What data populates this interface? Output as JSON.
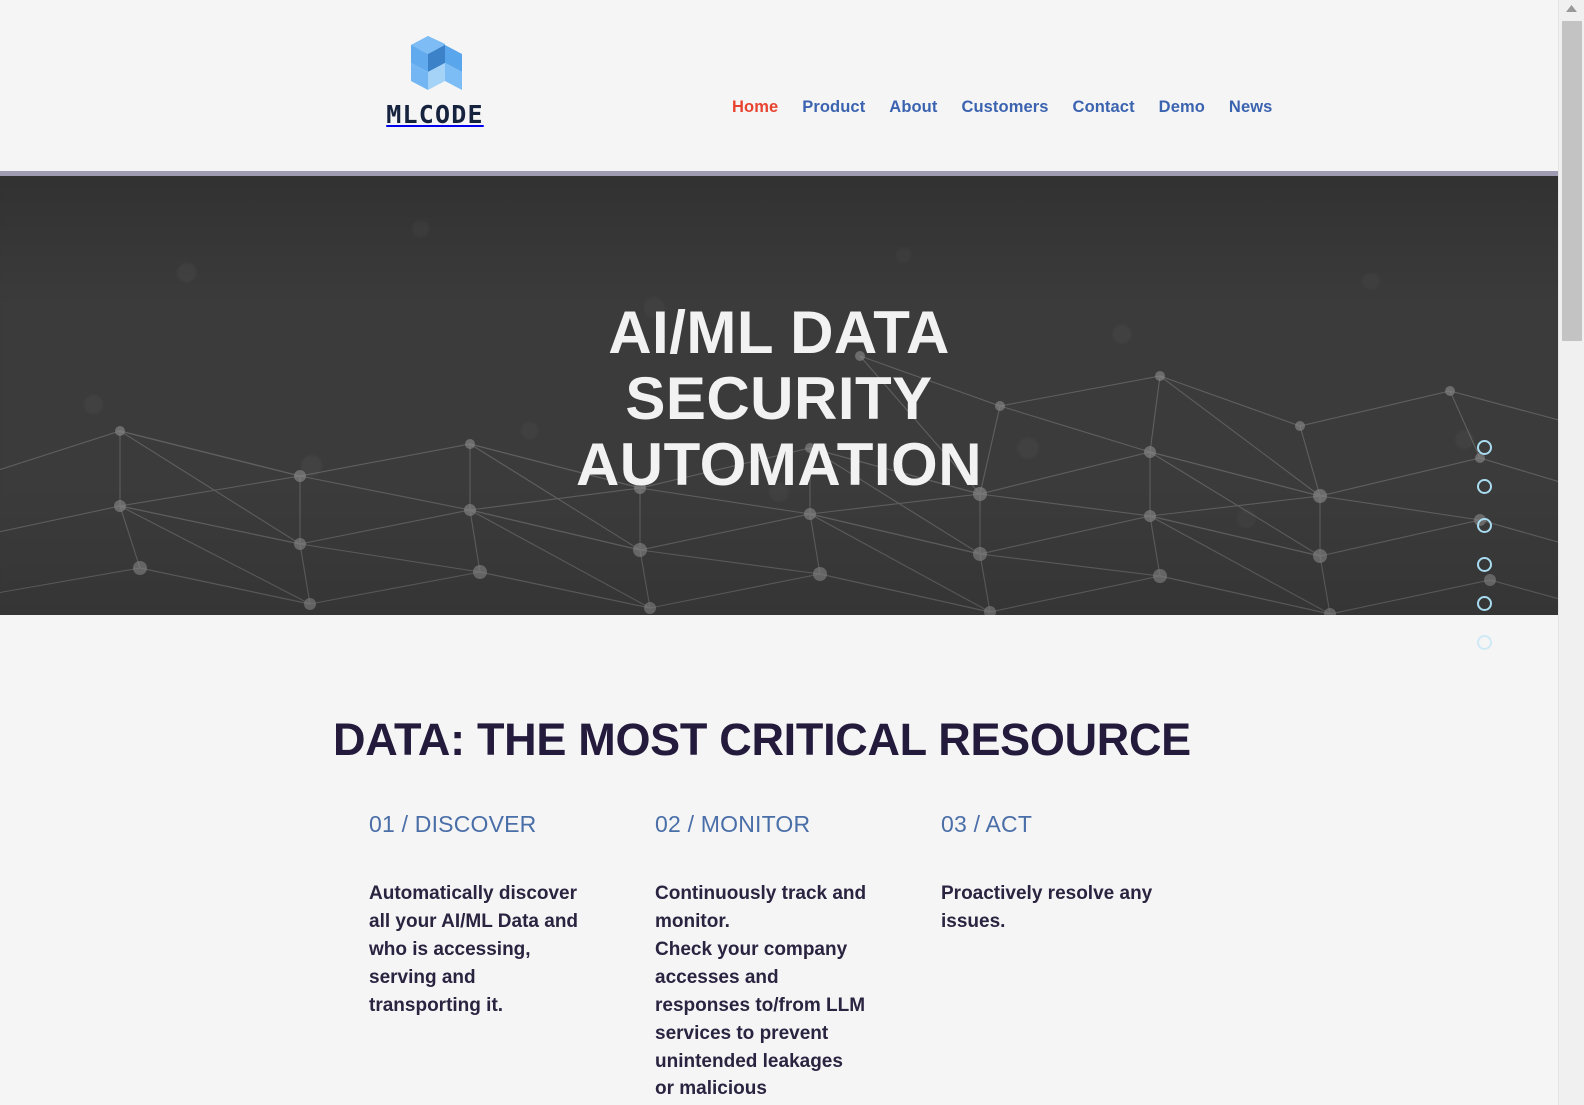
{
  "brand": {
    "wordmark": "MLCODE",
    "logo_icon": "isometric-cube-logo",
    "logo_colors": [
      "#5fa8ee",
      "#8cc6f5",
      "#2f6fae",
      "#4c9ae8"
    ],
    "wordmark_color": "#16233f"
  },
  "nav": {
    "items": [
      {
        "label": "Home",
        "active": true
      },
      {
        "label": "Product",
        "active": false
      },
      {
        "label": "About",
        "active": false
      },
      {
        "label": "Customers",
        "active": false
      },
      {
        "label": "Contact",
        "active": false
      },
      {
        "label": "Demo",
        "active": false
      },
      {
        "label": "News",
        "active": false
      }
    ],
    "link_color": "#3b63b0",
    "active_color": "#e8432f"
  },
  "hero": {
    "title_line1": "AI/ML DATA",
    "title_line2": "SECURITY",
    "title_line3": "AUTOMATION",
    "scroll_icon": "chevron-down-icon",
    "background_color": "#3b3b3b",
    "text_color": "#f2f2f2"
  },
  "dot_nav": {
    "icon": "slide-dot-indicator",
    "count": 6,
    "dot_color": "#a9dcf0",
    "items": [
      {
        "state": "normal"
      },
      {
        "state": "normal"
      },
      {
        "state": "normal"
      },
      {
        "state": "normal"
      },
      {
        "state": "normal"
      },
      {
        "state": "pale"
      }
    ]
  },
  "section": {
    "title": "DATA: THE MOST CRITICAL RESOURCE",
    "title_color": "#231a3c",
    "columns": [
      {
        "heading": "01 / DISCOVER",
        "body": "Automatically discover all your AI/ML Data and who is accessing, serving and transporting it."
      },
      {
        "heading": "02 / MONITOR",
        "body": "Continuously track and monitor.\nCheck your company accesses and responses to/from LLM services to prevent unintended leakages or malicious"
      },
      {
        "heading": "03 / ACT",
        "body": "Proactively resolve any issues."
      }
    ],
    "heading_color": "#4a6fa8",
    "body_color": "#2a2440"
  },
  "scrollbar": {
    "up_arrow_icon": "scroll-up-arrow-icon",
    "thumb": "scrollbar-thumb"
  }
}
